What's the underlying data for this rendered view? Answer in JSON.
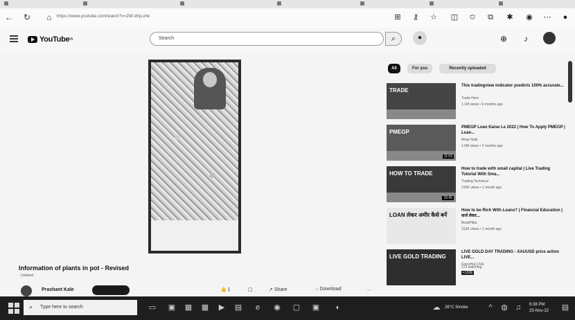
{
  "browser": {
    "url": "https://www.youtube.com/watch?v=ZW-dhjLxhk"
  },
  "header": {
    "logo_text": "YouTube",
    "logo_sup": "IN",
    "search_placeholder": "Search"
  },
  "chips": [
    "All",
    "For you",
    "Recently uploaded"
  ],
  "video": {
    "title": "Information of plants in pot - Revised",
    "visibility": "Unlisted",
    "channel": "Prashant Kale",
    "subscribe": "Subscribe",
    "actions": {
      "like": "1",
      "share": "Share",
      "download": "Download",
      "more": "..."
    }
  },
  "recommendations": [
    {
      "title": "This tradingview indicator predicts 100% accurate...",
      "channel": "Trade Hero",
      "meta": "1.1M views • 6 months ago",
      "thumb_text": "TRADE",
      "duration": "",
      "color": "#444"
    },
    {
      "title": "PMEGP Loan Kaise Le 2022 | How To Apply PMEGP | Loan...",
      "channel": "Amar Naik",
      "meta": "1.9M views • 2 months ago",
      "thumb_text": "PMEGP",
      "duration": "11:03",
      "color": "#5a5a5a"
    },
    {
      "title": "How to trade with small capital | Live Trading Tutorial With Sma...",
      "channel": "Trading Technical",
      "meta": "133K views • 1 month ago",
      "thumb_text": "HOW TO TRADE",
      "duration": "15:45",
      "color": "#3a3a3a"
    },
    {
      "title": "How to be Rich With Loans? | Financial Education | कर्ज लेकर...",
      "channel": "BookPillar",
      "meta": "313K views • 1 month ago",
      "thumb_text": "LOAN लेकर अमीर कैसे बनें",
      "duration": "",
      "color": "#e8e8e8"
    },
    {
      "title": "LIVE GOLD DAY TRADING - XAUUSD price action LIVE...",
      "channel": "ForexHut LIVE",
      "meta": "273 watching",
      "thumb_text": "LIVE GOLD TRADING",
      "duration": "",
      "badge": "• LIVE",
      "color": "#2e2e2e"
    }
  ],
  "taskbar": {
    "search_placeholder": "Type here to search",
    "weather": "26°C Smoke",
    "time": "6:38 PM",
    "date": "25-Nov-22"
  }
}
